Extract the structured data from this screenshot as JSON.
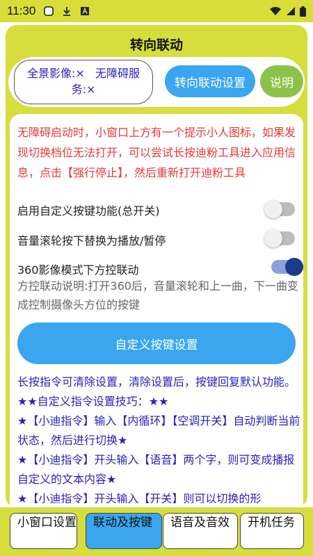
{
  "statusbar": {
    "time": "11:30"
  },
  "header": {
    "title": "转向联动"
  },
  "status": {
    "line1": "全景影像:×   无障碍服",
    "line2": "务:×"
  },
  "buttons": {
    "link_settings": "转向联动设置",
    "help": "说明",
    "custom_keys": "自定义按键设置"
  },
  "warning": "无障碍启动时，小窗口上方有一个提示小人图标，如果发现切换档位无法打开，可以尝试长按迪粉工具进入应用信息，点击【强行停止】，然后重新打开迪粉工具",
  "settings": [
    {
      "label": "启用自定义按键功能(总开关)",
      "on": false
    },
    {
      "label": "音量滚轮按下替换为播放/暂停",
      "on": false
    },
    {
      "label": "360影像模式下方控联动",
      "on": true
    }
  ],
  "description": "方控联动说明:打开360后，音量滚轮和上一曲，下一曲变成控制摄像头方位的按键",
  "tips": [
    "长按指令可清除设置，清除设置后，按键回复默认功能。",
    "★★自定义指令设置技巧：★★",
    "★【小迪指令】输入【内循环】【空调开关】自动判断当前状态，然后进行切换★",
    "★【小迪指令】开头输入【语音】两个字，则可变成播报自定义的文本内容★",
    "★【小迪指令】开头输入【开关】则可以切换的形"
  ],
  "tabs": [
    {
      "label": "小窗口设置",
      "active": false
    },
    {
      "label": "联动及按键",
      "active": true
    },
    {
      "label": "语音及音效",
      "active": false
    },
    {
      "label": "开机任务",
      "active": false
    }
  ],
  "colors": {
    "accent_yellow": "#d5de3c",
    "button_blue": "#3aa6ef",
    "help_green": "#8bc34a",
    "warning_red": "#e53935",
    "tip_blue": "#2a1fb7"
  }
}
